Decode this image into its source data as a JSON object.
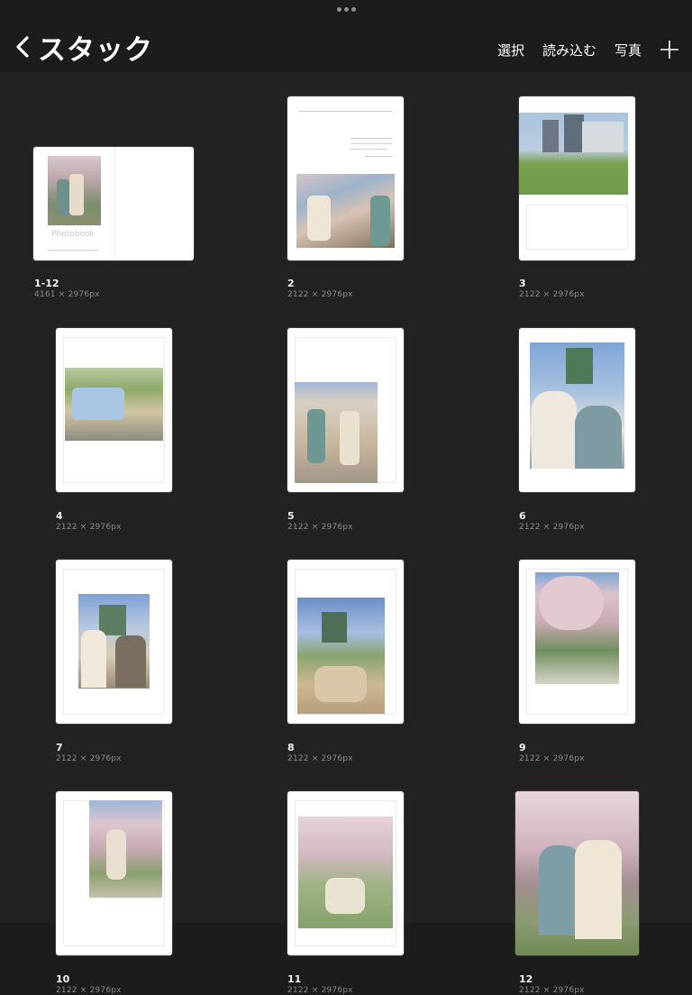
{
  "header": {
    "back_icon": "chevron-left-icon",
    "title": "スタック",
    "actions": {
      "select": "選択",
      "import": "読み込む",
      "photo": "写真",
      "add_icon": "plus-icon"
    }
  },
  "pages": [
    {
      "label": "1-12",
      "size": "4161 × 2976px",
      "cover_text": "Photobook"
    },
    {
      "label": "2",
      "size": "2122 × 2976px"
    },
    {
      "label": "3",
      "size": "2122 × 2976px"
    },
    {
      "label": "4",
      "size": "2122 × 2976px"
    },
    {
      "label": "5",
      "size": "2122 × 2976px"
    },
    {
      "label": "6",
      "size": "2122 × 2976px"
    },
    {
      "label": "7",
      "size": "2122 × 2976px"
    },
    {
      "label": "8",
      "size": "2122 × 2976px"
    },
    {
      "label": "9",
      "size": "2122 × 2976px"
    },
    {
      "label": "10",
      "size": "2122 × 2976px"
    },
    {
      "label": "11",
      "size": "2122 × 2976px"
    },
    {
      "label": "12",
      "size": "2122 × 2976px"
    }
  ],
  "colors": {
    "background": "#1c1c1c",
    "grid_background": "#222222",
    "thumbnail": "#ffffff",
    "secondary_text": "#8a8a8a"
  }
}
